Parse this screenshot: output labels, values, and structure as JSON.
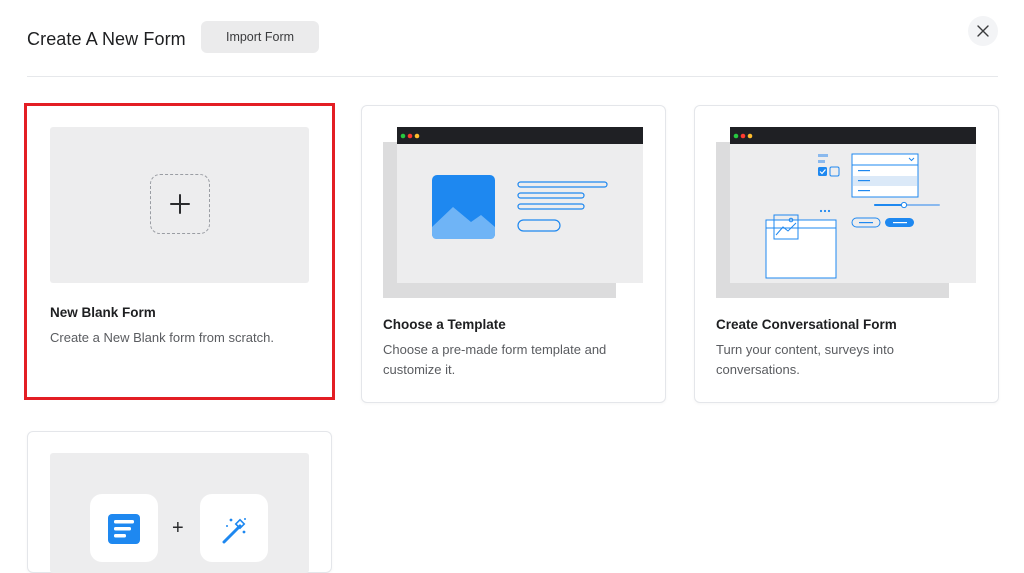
{
  "header": {
    "title": "Create A New Form",
    "import_label": "Import Form"
  },
  "cards": [
    {
      "title": "New Blank Form",
      "desc": "Create a New Blank form from scratch.",
      "selected": true
    },
    {
      "title": "Choose a Template",
      "desc_line1": "Choose a pre-made form template and",
      "desc_line2": "customize it."
    },
    {
      "title": "Create Conversational Form",
      "desc_line1": "Turn your content, surveys into",
      "desc_line2": "conversations."
    },
    {
      "plus": "+"
    }
  ],
  "icons": {
    "close": "close-icon",
    "blank_plus": "plus-icon",
    "template_preview": "template-preview-illustration",
    "conversational_preview": "conversational-preview-illustration",
    "form_app": "form-app-icon",
    "magic_wand": "magic-wand-icon"
  },
  "colors": {
    "selection_outline": "#e31e24",
    "accent_blue": "#1e88f0",
    "window_bar": "#1f2024"
  }
}
